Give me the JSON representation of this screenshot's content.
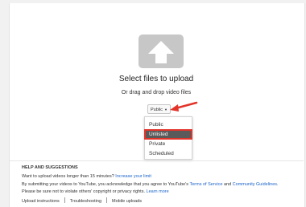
{
  "upload": {
    "title": "Select files to upload",
    "subtitle": "Or drag and drop video files",
    "icon": "upload-arrow-icon"
  },
  "privacy": {
    "selected_label": "Public",
    "options": [
      "Public",
      "Unlisted",
      "Private",
      "Scheduled"
    ],
    "highlighted": "Unlisted"
  },
  "help": {
    "title": "HELP AND SUGGESTIONS",
    "line1_text": "Want to upload videos longer than 15 minutes? ",
    "line1_link": "Increase your limit",
    "line2_text": "By submitting your videos to YouTube, you acknowledge that you agree to YouTube's ",
    "line2_link1": "Terms of Service",
    "line2_and": " and ",
    "line2_link2": "Community Guidelines",
    "line2_end": ".",
    "line3_text": "Please be sure not to violate others' copyright or privacy rights. ",
    "line3_link": "Learn more",
    "footer_links": [
      "Upload instructions",
      "Troubleshooting",
      "Mobile uploads"
    ]
  },
  "colors": {
    "accent_red": "#e3342a",
    "link_blue": "#1a63c8",
    "icon_gray": "#c7c7c7"
  }
}
